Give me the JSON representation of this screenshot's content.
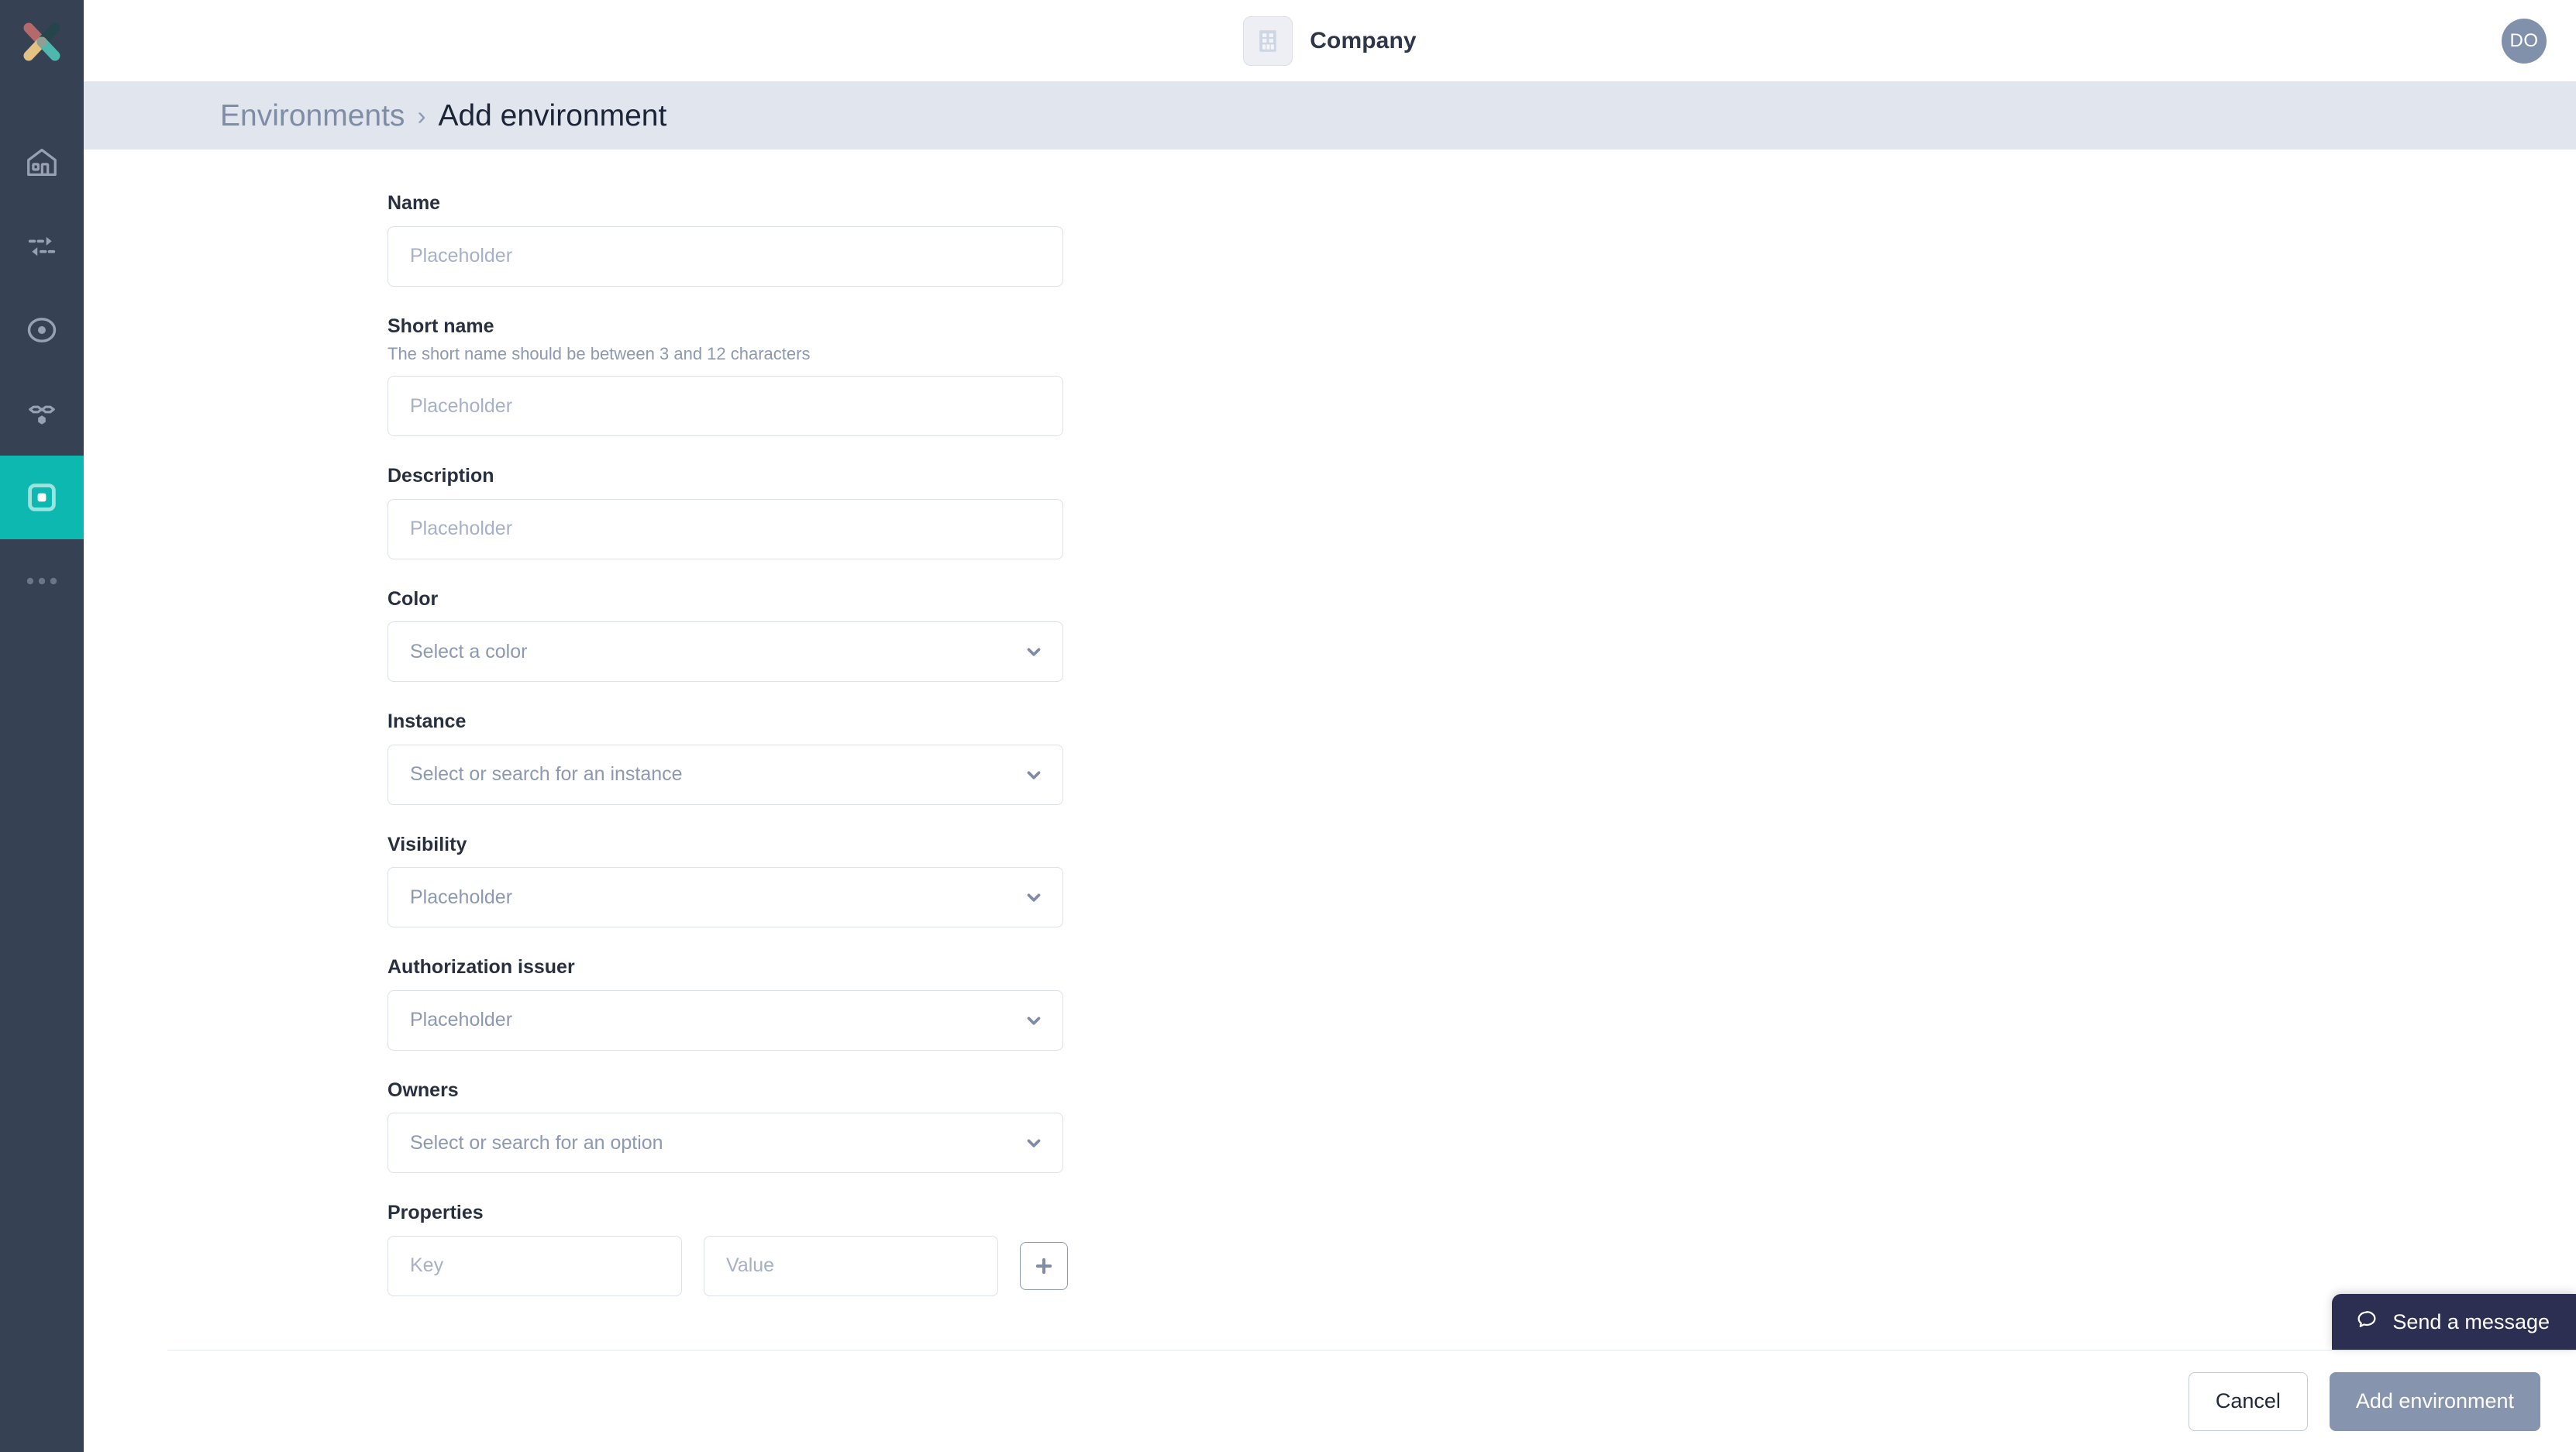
{
  "sidebar": {
    "logo_name": "app-logo",
    "logo_colors": [
      "#B46A6A",
      "#25454C",
      "#E3C284",
      "#4FB8AE"
    ],
    "active_color": "#0CB8AF",
    "background": "#364153",
    "items": [
      {
        "name": "home",
        "label": "Home",
        "icon": "house-icon",
        "active": false
      },
      {
        "name": "transfers",
        "label": "Transfers",
        "icon": "exchange-arrows-icon",
        "active": false
      },
      {
        "name": "targets",
        "label": "Targets",
        "icon": "circle-dot-icon",
        "active": false
      },
      {
        "name": "network",
        "label": "Network",
        "icon": "nodes-network-icon",
        "active": false
      },
      {
        "name": "environments",
        "label": "Environments",
        "icon": "square-in-square-icon",
        "active": true
      },
      {
        "name": "more",
        "label": "More",
        "icon": "ellipsis-icon",
        "active": false
      }
    ]
  },
  "topbar": {
    "company_icon": "building-icon",
    "company_name": "Company",
    "avatar_initials": "DO",
    "avatar_color": "#8190AB"
  },
  "breadcrumb": {
    "parent": "Environments",
    "separator": "›",
    "current": "Add environment",
    "band_color": "#E1E5ED"
  },
  "form": {
    "fields": [
      {
        "key": "name",
        "label": "Name",
        "hint": "",
        "type": "text",
        "value": "",
        "placeholder": "Placeholder"
      },
      {
        "key": "short_name",
        "label": "Short name",
        "hint": "The short name should be between 3 and 12 characters",
        "type": "text",
        "value": "",
        "placeholder": "Placeholder"
      },
      {
        "key": "description",
        "label": "Description",
        "hint": "",
        "type": "text",
        "value": "",
        "placeholder": "Placeholder"
      },
      {
        "key": "color",
        "label": "Color",
        "hint": "",
        "type": "select",
        "value": "",
        "placeholder": "Select a color"
      },
      {
        "key": "instance",
        "label": "Instance",
        "hint": "",
        "type": "select",
        "value": "",
        "placeholder": "Select or search for an instance"
      },
      {
        "key": "visibility",
        "label": "Visibility",
        "hint": "",
        "type": "select",
        "value": "",
        "placeholder": "Placeholder"
      },
      {
        "key": "authorization_issuer",
        "label": "Authorization issuer",
        "hint": "",
        "type": "select",
        "value": "",
        "placeholder": "Placeholder"
      },
      {
        "key": "owners",
        "label": "Owners",
        "hint": "",
        "type": "select",
        "value": "",
        "placeholder": "Select or search for an option"
      }
    ],
    "properties": {
      "label": "Properties",
      "key_placeholder": "Key",
      "key_value": "",
      "value_placeholder": "Value",
      "value_value": "",
      "add_icon": "plus-icon"
    }
  },
  "footer": {
    "cancel_label": "Cancel",
    "submit_label": "Add environment",
    "submit_color": "#8694AE"
  },
  "chat": {
    "label": "Send a message",
    "icon": "chat-bubble-icon",
    "background": "#2C2F52"
  }
}
